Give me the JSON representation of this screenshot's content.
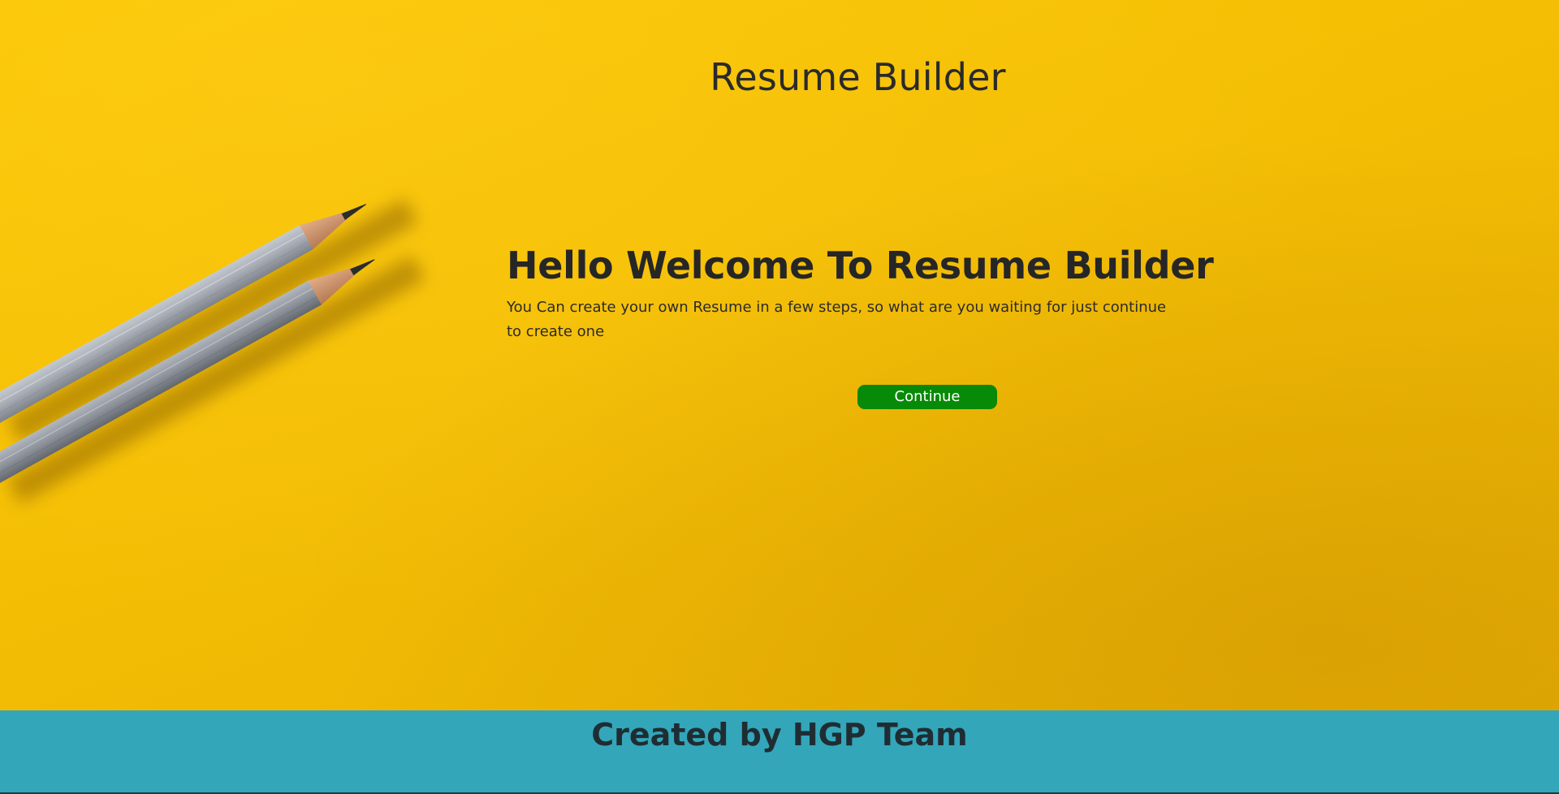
{
  "header": {
    "title": "Resume Builder"
  },
  "welcome": {
    "heading": "Hello Welcome To Resume Builder",
    "text": "You Can create your own Resume in a few steps, so what are you waiting for just continue to create one"
  },
  "actions": {
    "continue_label": "Continue"
  },
  "footer": {
    "text": "Created by HGP Team"
  },
  "colors": {
    "background": "#f4be04",
    "button": "#078a07",
    "footer": "#33a6ba"
  },
  "images": {
    "background": "pencils-on-yellow-paper"
  }
}
